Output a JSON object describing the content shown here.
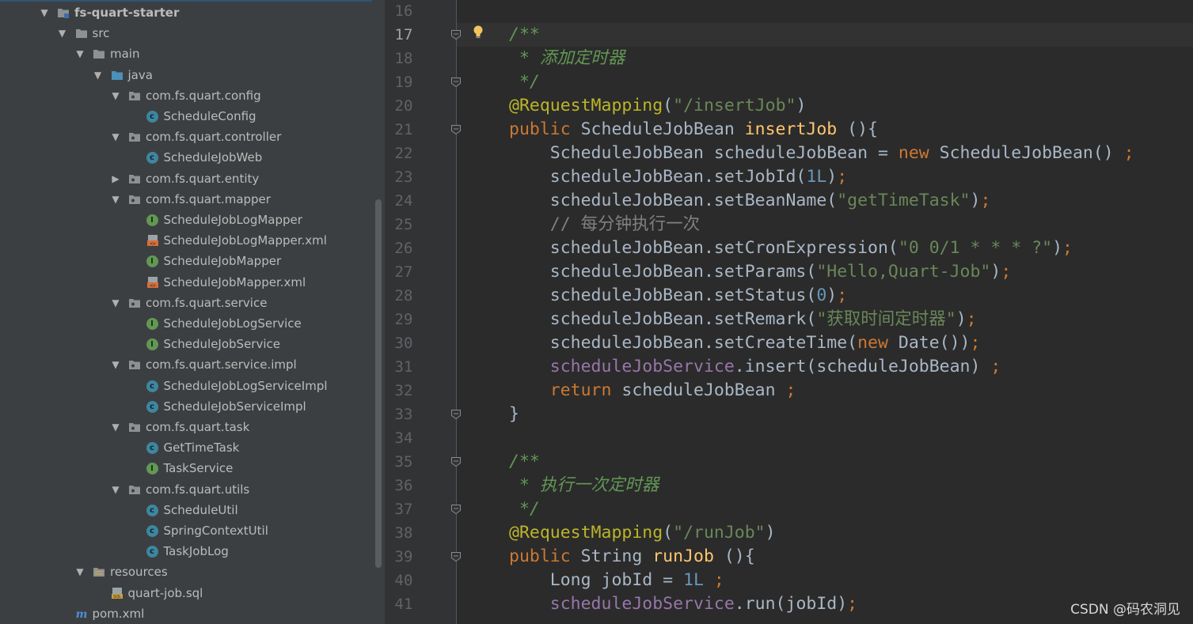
{
  "project_tree": [
    {
      "label": "fs-quart-starter",
      "type": "module",
      "expanded": true,
      "level": 0,
      "bold": true
    },
    {
      "label": "src",
      "type": "folder",
      "expanded": true,
      "level": 1
    },
    {
      "label": "main",
      "type": "folder",
      "expanded": true,
      "level": 2
    },
    {
      "label": "java",
      "type": "source-folder",
      "expanded": true,
      "level": 3
    },
    {
      "label": "com.fs.quart.config",
      "type": "package",
      "expanded": true,
      "level": 4
    },
    {
      "label": "ScheduleConfig",
      "type": "class",
      "level": 5
    },
    {
      "label": "com.fs.quart.controller",
      "type": "package",
      "expanded": true,
      "level": 4
    },
    {
      "label": "ScheduleJobWeb",
      "type": "class",
      "level": 5
    },
    {
      "label": "com.fs.quart.entity",
      "type": "package",
      "expanded": false,
      "level": 4
    },
    {
      "label": "com.fs.quart.mapper",
      "type": "package",
      "expanded": true,
      "level": 4
    },
    {
      "label": "ScheduleJobLogMapper",
      "type": "interface",
      "level": 5
    },
    {
      "label": "ScheduleJobLogMapper.xml",
      "type": "xml",
      "level": 5
    },
    {
      "label": "ScheduleJobMapper",
      "type": "interface",
      "level": 5
    },
    {
      "label": "ScheduleJobMapper.xml",
      "type": "xml",
      "level": 5
    },
    {
      "label": "com.fs.quart.service",
      "type": "package",
      "expanded": true,
      "level": 4
    },
    {
      "label": "ScheduleJobLogService",
      "type": "interface",
      "level": 5
    },
    {
      "label": "ScheduleJobService",
      "type": "interface",
      "level": 5
    },
    {
      "label": "com.fs.quart.service.impl",
      "type": "package",
      "expanded": true,
      "level": 4
    },
    {
      "label": "ScheduleJobLogServiceImpl",
      "type": "class",
      "level": 5
    },
    {
      "label": "ScheduleJobServiceImpl",
      "type": "class",
      "level": 5
    },
    {
      "label": "com.fs.quart.task",
      "type": "package",
      "expanded": true,
      "level": 4
    },
    {
      "label": "GetTimeTask",
      "type": "class",
      "level": 5
    },
    {
      "label": "TaskService",
      "type": "interface",
      "level": 5
    },
    {
      "label": "com.fs.quart.utils",
      "type": "package",
      "expanded": true,
      "level": 4
    },
    {
      "label": "ScheduleUtil",
      "type": "class",
      "level": 5
    },
    {
      "label": "SpringContextUtil",
      "type": "class",
      "level": 5
    },
    {
      "label": "TaskJobLog",
      "type": "class",
      "level": 5
    },
    {
      "label": "resources",
      "type": "resources-folder",
      "expanded": true,
      "level": 2
    },
    {
      "label": "quart-job.sql",
      "type": "sql",
      "level": 3
    },
    {
      "label": "pom.xml",
      "type": "maven",
      "level": 1
    }
  ],
  "editor": {
    "current_line": 17,
    "lines": [
      {
        "n": "16",
        "tokens": []
      },
      {
        "n": "17",
        "tokens": [
          [
            "doc",
            "/**"
          ]
        ]
      },
      {
        "n": "18",
        "tokens": [
          [
            "doc",
            " * 添加定时器"
          ]
        ]
      },
      {
        "n": "19",
        "tokens": [
          [
            "doc",
            " */"
          ]
        ]
      },
      {
        "n": "20",
        "tokens": [
          [
            "ann",
            "@RequestMapping"
          ],
          [
            "plain",
            "("
          ],
          [
            "str",
            "\"/insertJob\""
          ],
          [
            "plain",
            ")"
          ]
        ]
      },
      {
        "n": "21",
        "tokens": [
          [
            "kw",
            "public "
          ],
          [
            "plain",
            "ScheduleJobBean "
          ],
          [
            "fn",
            "insertJob"
          ],
          [
            "plain",
            " (){"
          ]
        ]
      },
      {
        "n": "22",
        "tokens": [
          [
            "plain",
            "    ScheduleJobBean scheduleJobBean = "
          ],
          [
            "kw",
            "new "
          ],
          [
            "plain",
            "ScheduleJobBean() "
          ],
          [
            "kw",
            ";"
          ]
        ]
      },
      {
        "n": "23",
        "tokens": [
          [
            "plain",
            "    scheduleJobBean.setJobId("
          ],
          [
            "num",
            "1L"
          ],
          [
            "plain",
            ")"
          ],
          [
            "kw",
            ";"
          ]
        ]
      },
      {
        "n": "24",
        "tokens": [
          [
            "plain",
            "    scheduleJobBean.setBeanName("
          ],
          [
            "str",
            "\"getTimeTask\""
          ],
          [
            "plain",
            ")"
          ],
          [
            "kw",
            ";"
          ]
        ]
      },
      {
        "n": "25",
        "tokens": [
          [
            "cmt",
            "    // 每分钟执行一次"
          ]
        ]
      },
      {
        "n": "26",
        "tokens": [
          [
            "plain",
            "    scheduleJobBean.setCronExpression("
          ],
          [
            "str",
            "\"0 0/1 * * * ?\""
          ],
          [
            "plain",
            ")"
          ],
          [
            "kw",
            ";"
          ]
        ]
      },
      {
        "n": "27",
        "tokens": [
          [
            "plain",
            "    scheduleJobBean.setParams("
          ],
          [
            "str",
            "\"Hello,Quart-Job\""
          ],
          [
            "plain",
            ")"
          ],
          [
            "kw",
            ";"
          ]
        ]
      },
      {
        "n": "28",
        "tokens": [
          [
            "plain",
            "    scheduleJobBean.setStatus("
          ],
          [
            "num",
            "0"
          ],
          [
            "plain",
            ")"
          ],
          [
            "kw",
            ";"
          ]
        ]
      },
      {
        "n": "29",
        "tokens": [
          [
            "plain",
            "    scheduleJobBean.setRemark("
          ],
          [
            "str",
            "\"获取时间定时器\""
          ],
          [
            "plain",
            ")"
          ],
          [
            "kw",
            ";"
          ]
        ]
      },
      {
        "n": "30",
        "tokens": [
          [
            "plain",
            "    scheduleJobBean.setCreateTime("
          ],
          [
            "kw",
            "new "
          ],
          [
            "plain",
            "Date())"
          ],
          [
            "kw",
            ";"
          ]
        ]
      },
      {
        "n": "31",
        "tokens": [
          [
            "plain",
            "    "
          ],
          [
            "fld",
            "scheduleJobService"
          ],
          [
            "plain",
            ".insert(scheduleJobBean) "
          ],
          [
            "kw",
            ";"
          ]
        ]
      },
      {
        "n": "32",
        "tokens": [
          [
            "plain",
            "    "
          ],
          [
            "kw",
            "return "
          ],
          [
            "plain",
            "scheduleJobBean "
          ],
          [
            "kw",
            ";"
          ]
        ]
      },
      {
        "n": "33",
        "tokens": [
          [
            "plain",
            "}"
          ]
        ]
      },
      {
        "n": "34",
        "tokens": []
      },
      {
        "n": "35",
        "tokens": [
          [
            "doc",
            "/**"
          ]
        ]
      },
      {
        "n": "36",
        "tokens": [
          [
            "doc",
            " * 执行一次定时器"
          ]
        ]
      },
      {
        "n": "37",
        "tokens": [
          [
            "doc",
            " */"
          ]
        ]
      },
      {
        "n": "38",
        "tokens": [
          [
            "ann",
            "@RequestMapping"
          ],
          [
            "plain",
            "("
          ],
          [
            "str",
            "\"/runJob\""
          ],
          [
            "plain",
            ")"
          ]
        ]
      },
      {
        "n": "39",
        "tokens": [
          [
            "kw",
            "public "
          ],
          [
            "plain",
            "String "
          ],
          [
            "fn",
            "runJob"
          ],
          [
            "plain",
            " (){"
          ]
        ]
      },
      {
        "n": "40",
        "tokens": [
          [
            "plain",
            "    Long jobId = "
          ],
          [
            "num",
            "1L"
          ],
          [
            "kw",
            " ;"
          ]
        ]
      },
      {
        "n": "41",
        "tokens": [
          [
            "plain",
            "    "
          ],
          [
            "fld",
            "scheduleJobService"
          ],
          [
            "plain",
            ".run(jobId)"
          ],
          [
            "kw",
            ";"
          ]
        ]
      }
    ],
    "fold_markers": [
      "17",
      "19",
      "21",
      "33",
      "35",
      "37",
      "39"
    ]
  },
  "watermark": "CSDN @码农洞见",
  "colors": {
    "sidebar_bg": "#3c3f41",
    "editor_bg": "#2b2b2b",
    "gutter_bg": "#313335",
    "keyword": "#cc7832",
    "string": "#6a8759",
    "number": "#6897bb",
    "annotation": "#bbb529",
    "method": "#ffc66d",
    "field": "#9876aa",
    "doc_comment": "#629755",
    "line_comment": "#808080"
  }
}
